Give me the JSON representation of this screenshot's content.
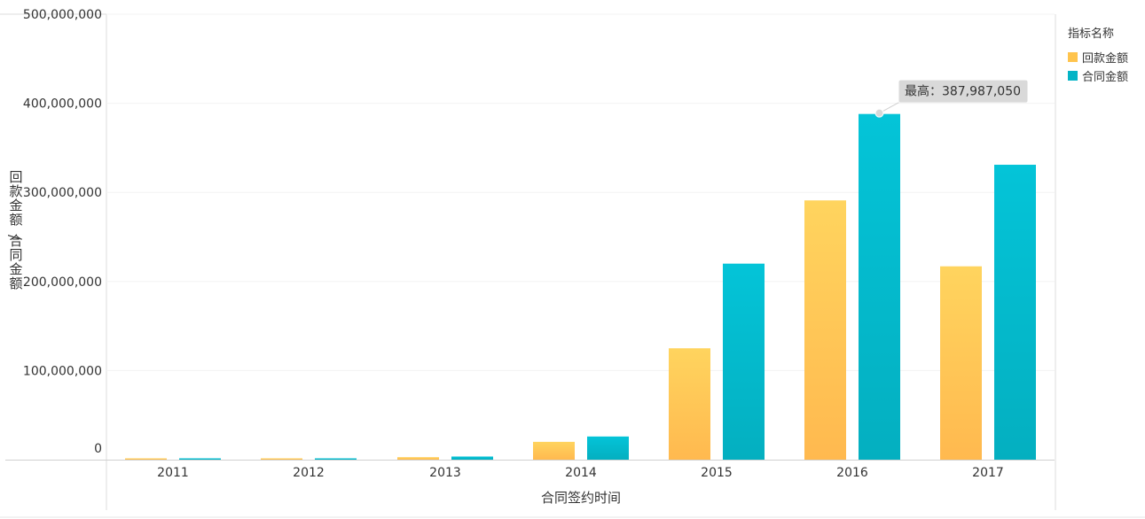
{
  "chart_data": {
    "type": "bar",
    "categories": [
      "2011",
      "2012",
      "2013",
      "2014",
      "2015",
      "2016",
      "2017"
    ],
    "series": [
      {
        "name": "回款金额",
        "color": "#FFC44D",
        "values": [
          1000000,
          300000,
          2800000,
          20000000,
          125000000,
          291000000,
          217000000
        ]
      },
      {
        "name": "合同金额",
        "color": "#04B4C6",
        "values": [
          1500000,
          500000,
          3500000,
          26000000,
          220000000,
          387987050,
          331000000
        ]
      }
    ],
    "xlabel": "合同签约时间",
    "ylabel": "回款金额/合同金额",
    "ylim": [
      0,
      500000000
    ],
    "yticks": [
      "0",
      "100,000,000",
      "200,000,000",
      "300,000,000",
      "400,000,000",
      "500,000,000"
    ],
    "legend": {
      "title": "指标名称",
      "placement": "right"
    },
    "annotation": {
      "text": "最高：387,987,050",
      "series": "合同金额",
      "category": "2016"
    },
    "grid": true
  }
}
